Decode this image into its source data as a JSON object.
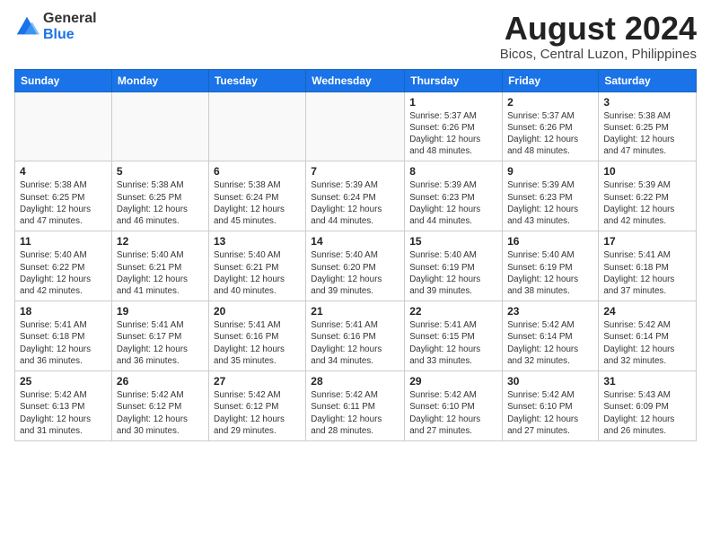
{
  "logo": {
    "general": "General",
    "blue": "Blue"
  },
  "title": {
    "month_year": "August 2024",
    "location": "Bicos, Central Luzon, Philippines"
  },
  "weekdays": [
    "Sunday",
    "Monday",
    "Tuesday",
    "Wednesday",
    "Thursday",
    "Friday",
    "Saturday"
  ],
  "weeks": [
    [
      {
        "day": "",
        "info": ""
      },
      {
        "day": "",
        "info": ""
      },
      {
        "day": "",
        "info": ""
      },
      {
        "day": "",
        "info": ""
      },
      {
        "day": "1",
        "info": "Sunrise: 5:37 AM\nSunset: 6:26 PM\nDaylight: 12 hours\nand 48 minutes."
      },
      {
        "day": "2",
        "info": "Sunrise: 5:37 AM\nSunset: 6:26 PM\nDaylight: 12 hours\nand 48 minutes."
      },
      {
        "day": "3",
        "info": "Sunrise: 5:38 AM\nSunset: 6:25 PM\nDaylight: 12 hours\nand 47 minutes."
      }
    ],
    [
      {
        "day": "4",
        "info": "Sunrise: 5:38 AM\nSunset: 6:25 PM\nDaylight: 12 hours\nand 47 minutes."
      },
      {
        "day": "5",
        "info": "Sunrise: 5:38 AM\nSunset: 6:25 PM\nDaylight: 12 hours\nand 46 minutes."
      },
      {
        "day": "6",
        "info": "Sunrise: 5:38 AM\nSunset: 6:24 PM\nDaylight: 12 hours\nand 45 minutes."
      },
      {
        "day": "7",
        "info": "Sunrise: 5:39 AM\nSunset: 6:24 PM\nDaylight: 12 hours\nand 44 minutes."
      },
      {
        "day": "8",
        "info": "Sunrise: 5:39 AM\nSunset: 6:23 PM\nDaylight: 12 hours\nand 44 minutes."
      },
      {
        "day": "9",
        "info": "Sunrise: 5:39 AM\nSunset: 6:23 PM\nDaylight: 12 hours\nand 43 minutes."
      },
      {
        "day": "10",
        "info": "Sunrise: 5:39 AM\nSunset: 6:22 PM\nDaylight: 12 hours\nand 42 minutes."
      }
    ],
    [
      {
        "day": "11",
        "info": "Sunrise: 5:40 AM\nSunset: 6:22 PM\nDaylight: 12 hours\nand 42 minutes."
      },
      {
        "day": "12",
        "info": "Sunrise: 5:40 AM\nSunset: 6:21 PM\nDaylight: 12 hours\nand 41 minutes."
      },
      {
        "day": "13",
        "info": "Sunrise: 5:40 AM\nSunset: 6:21 PM\nDaylight: 12 hours\nand 40 minutes."
      },
      {
        "day": "14",
        "info": "Sunrise: 5:40 AM\nSunset: 6:20 PM\nDaylight: 12 hours\nand 39 minutes."
      },
      {
        "day": "15",
        "info": "Sunrise: 5:40 AM\nSunset: 6:19 PM\nDaylight: 12 hours\nand 39 minutes."
      },
      {
        "day": "16",
        "info": "Sunrise: 5:40 AM\nSunset: 6:19 PM\nDaylight: 12 hours\nand 38 minutes."
      },
      {
        "day": "17",
        "info": "Sunrise: 5:41 AM\nSunset: 6:18 PM\nDaylight: 12 hours\nand 37 minutes."
      }
    ],
    [
      {
        "day": "18",
        "info": "Sunrise: 5:41 AM\nSunset: 6:18 PM\nDaylight: 12 hours\nand 36 minutes."
      },
      {
        "day": "19",
        "info": "Sunrise: 5:41 AM\nSunset: 6:17 PM\nDaylight: 12 hours\nand 36 minutes."
      },
      {
        "day": "20",
        "info": "Sunrise: 5:41 AM\nSunset: 6:16 PM\nDaylight: 12 hours\nand 35 minutes."
      },
      {
        "day": "21",
        "info": "Sunrise: 5:41 AM\nSunset: 6:16 PM\nDaylight: 12 hours\nand 34 minutes."
      },
      {
        "day": "22",
        "info": "Sunrise: 5:41 AM\nSunset: 6:15 PM\nDaylight: 12 hours\nand 33 minutes."
      },
      {
        "day": "23",
        "info": "Sunrise: 5:42 AM\nSunset: 6:14 PM\nDaylight: 12 hours\nand 32 minutes."
      },
      {
        "day": "24",
        "info": "Sunrise: 5:42 AM\nSunset: 6:14 PM\nDaylight: 12 hours\nand 32 minutes."
      }
    ],
    [
      {
        "day": "25",
        "info": "Sunrise: 5:42 AM\nSunset: 6:13 PM\nDaylight: 12 hours\nand 31 minutes."
      },
      {
        "day": "26",
        "info": "Sunrise: 5:42 AM\nSunset: 6:12 PM\nDaylight: 12 hours\nand 30 minutes."
      },
      {
        "day": "27",
        "info": "Sunrise: 5:42 AM\nSunset: 6:12 PM\nDaylight: 12 hours\nand 29 minutes."
      },
      {
        "day": "28",
        "info": "Sunrise: 5:42 AM\nSunset: 6:11 PM\nDaylight: 12 hours\nand 28 minutes."
      },
      {
        "day": "29",
        "info": "Sunrise: 5:42 AM\nSunset: 6:10 PM\nDaylight: 12 hours\nand 27 minutes."
      },
      {
        "day": "30",
        "info": "Sunrise: 5:42 AM\nSunset: 6:10 PM\nDaylight: 12 hours\nand 27 minutes."
      },
      {
        "day": "31",
        "info": "Sunrise: 5:43 AM\nSunset: 6:09 PM\nDaylight: 12 hours\nand 26 minutes."
      }
    ]
  ]
}
